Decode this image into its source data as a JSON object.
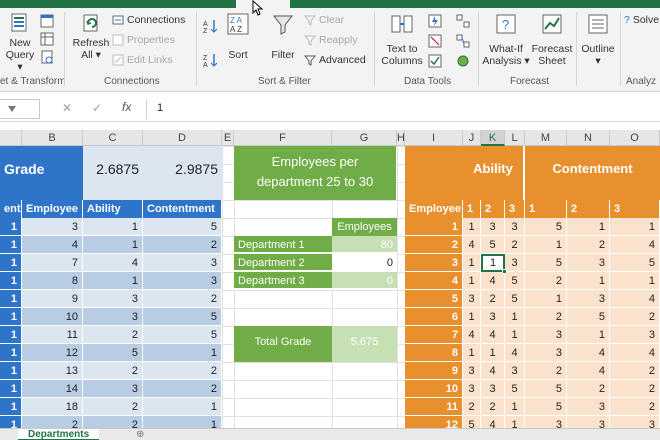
{
  "ribbon": {
    "get_transform": {
      "new_query": "New",
      "new_query_2": "Query",
      "group_label": "et & Transform"
    },
    "connections": {
      "refresh_all": "Refresh",
      "refresh_all_2": "All",
      "connections": "Connections",
      "properties": "Properties",
      "edit_links": "Edit Links",
      "group_label": "Connections"
    },
    "sort_filter": {
      "sort": "Sort",
      "filter": "Filter",
      "clear": "Clear",
      "reapply": "Reapply",
      "advanced": "Advanced",
      "group_label": "Sort & Filter"
    },
    "data_tools": {
      "text_to_columns": "Text to",
      "text_to_columns_2": "Columns",
      "group_label": "Data Tools"
    },
    "forecast": {
      "what_if": "What-If",
      "what_if_2": "Analysis",
      "forecast_sheet": "Forecast",
      "forecast_sheet_2": "Sheet",
      "group_label": "Forecast"
    },
    "outline": {
      "label": "Outline"
    },
    "analyze": {
      "solver": "Solve",
      "group_label": "Analyz"
    }
  },
  "formula_bar": {
    "cancel": "✕",
    "enter": "✓",
    "fx": "fx",
    "value": "1"
  },
  "columns": [
    "B",
    "C",
    "D",
    "E",
    "F",
    "G",
    "H",
    "I",
    "J",
    "K",
    "L",
    "M",
    "N",
    "O"
  ],
  "selected_column": "K",
  "left_table": {
    "grade_label": "Grade",
    "ability_avg": "2.6875",
    "contentment_avg": "2.9875",
    "headers": [
      "ent",
      "Employee",
      "Ability",
      "Contentment"
    ],
    "rows": [
      [
        "1",
        "3",
        "1",
        "5"
      ],
      [
        "1",
        "4",
        "1",
        "2"
      ],
      [
        "1",
        "7",
        "4",
        "3"
      ],
      [
        "1",
        "8",
        "1",
        "3"
      ],
      [
        "1",
        "9",
        "3",
        "2"
      ],
      [
        "1",
        "10",
        "3",
        "5"
      ],
      [
        "1",
        "11",
        "2",
        "5"
      ],
      [
        "1",
        "12",
        "5",
        "1"
      ],
      [
        "1",
        "13",
        "2",
        "2"
      ],
      [
        "1",
        "14",
        "3",
        "2"
      ],
      [
        "1",
        "18",
        "2",
        "1"
      ],
      [
        "1",
        "2",
        "2",
        "1"
      ]
    ]
  },
  "middle_table": {
    "title_line1": "Employees per",
    "title_line2": "department 25 to 30",
    "employees_header": "Employees",
    "departments": [
      {
        "name": "Department 1",
        "value": "80"
      },
      {
        "name": "Department  2",
        "value": "0"
      },
      {
        "name": "Department 3",
        "value": "0"
      }
    ],
    "total_label": "Total Grade",
    "total_value": "5.675"
  },
  "right_table": {
    "ability_label": "Ability",
    "contentment_label": "Contentment",
    "subheaders": [
      "Employee",
      "1",
      "2",
      "3",
      "1",
      "2",
      "3"
    ],
    "rows": [
      [
        "1",
        "1",
        "3",
        "3",
        "5",
        "1",
        "1"
      ],
      [
        "2",
        "4",
        "5",
        "2",
        "1",
        "2",
        "4"
      ],
      [
        "3",
        "1",
        "1",
        "3",
        "5",
        "3",
        "5"
      ],
      [
        "4",
        "1",
        "4",
        "5",
        "2",
        "1",
        "1"
      ],
      [
        "5",
        "3",
        "2",
        "5",
        "1",
        "3",
        "4"
      ],
      [
        "6",
        "1",
        "3",
        "1",
        "2",
        "5",
        "2"
      ],
      [
        "7",
        "4",
        "4",
        "1",
        "3",
        "1",
        "3"
      ],
      [
        "8",
        "1",
        "1",
        "4",
        "3",
        "4",
        "4"
      ],
      [
        "9",
        "3",
        "4",
        "3",
        "2",
        "4",
        "2"
      ],
      [
        "10",
        "3",
        "3",
        "5",
        "5",
        "2",
        "2"
      ],
      [
        "11",
        "2",
        "2",
        "1",
        "5",
        "3",
        "2"
      ],
      [
        "12",
        "5",
        "4",
        "1",
        "3",
        "3",
        "3"
      ]
    ]
  },
  "sheet_tabs": {
    "active": "Departments",
    "add": "⊕"
  },
  "colors": {
    "excel_green": "#217346",
    "blue_header": "#2e75c9",
    "blue_light": "#b8cce4",
    "blue_lighter": "#dce6f1",
    "green_title": "#70ad47",
    "green_light": "#c6e0b4",
    "orange": "#e88f2e",
    "orange_light": "#fbe2cd"
  }
}
